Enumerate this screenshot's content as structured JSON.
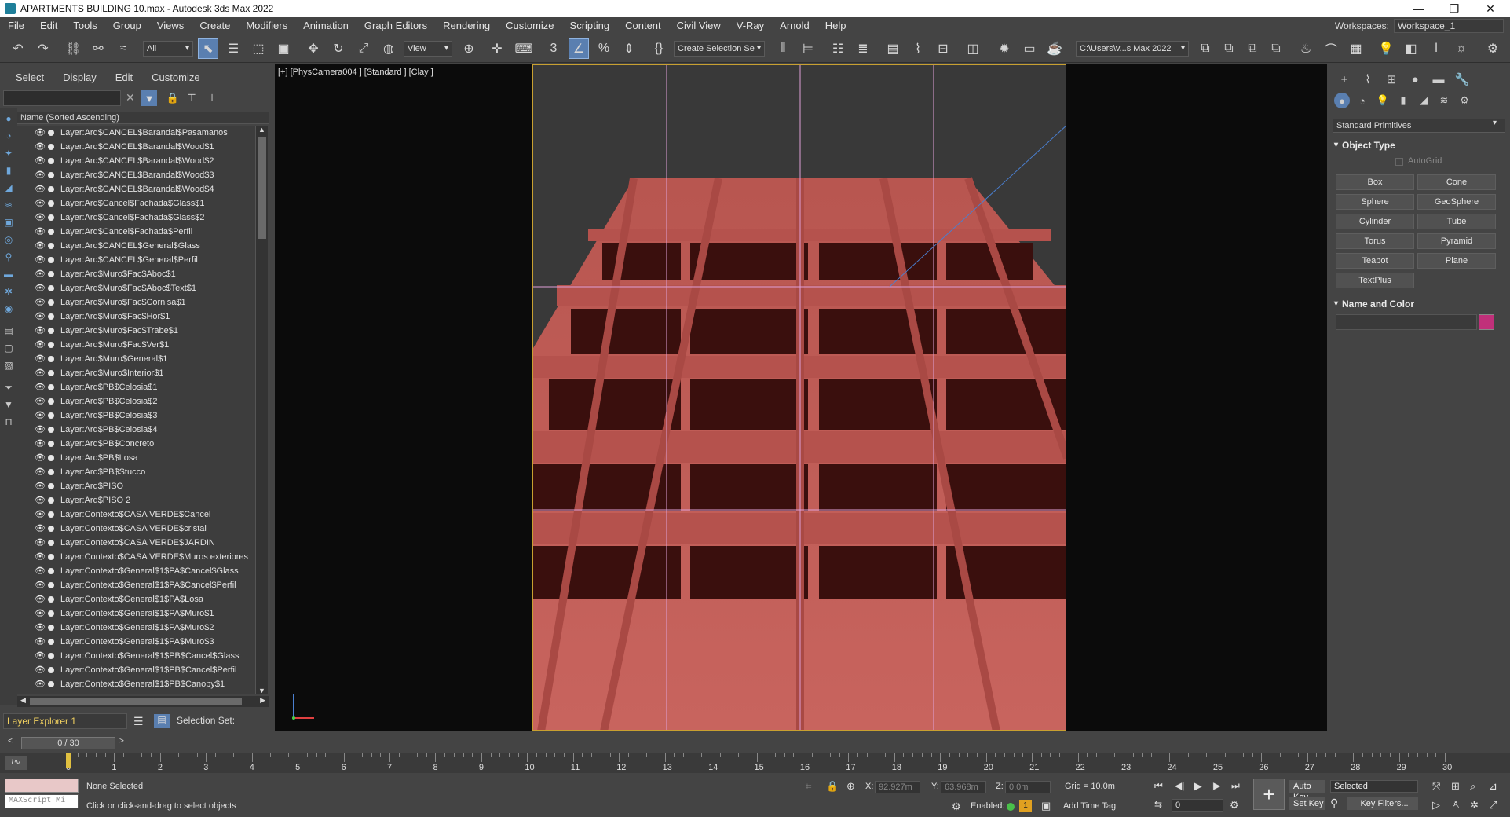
{
  "title": "APARTMENTS BUILDING 10.max - Autodesk 3ds Max 2022",
  "menu": [
    "File",
    "Edit",
    "Tools",
    "Group",
    "Views",
    "Create",
    "Modifiers",
    "Animation",
    "Graph Editors",
    "Rendering",
    "Customize",
    "Scripting",
    "Content",
    "Civil View",
    "V-Ray",
    "Arnold",
    "Help"
  ],
  "workspace": {
    "label": "Workspaces:",
    "value": "Workspace_1"
  },
  "toolbar": {
    "filter": "All",
    "refcoord": "View",
    "selection_set": "Create Selection Se",
    "path": "C:\\Users\\v...s Max 2022"
  },
  "scene_tabs": [
    "Select",
    "Display",
    "Edit",
    "Customize"
  ],
  "layer_header": "Name (Sorted Ascending)",
  "layers": [
    "Layer:Arq$CANCEL$Barandal$Pasamanos",
    "Layer:Arq$CANCEL$Barandal$Wood$1",
    "Layer:Arq$CANCEL$Barandal$Wood$2",
    "Layer:Arq$CANCEL$Barandal$Wood$3",
    "Layer:Arq$CANCEL$Barandal$Wood$4",
    "Layer:Arq$Cancel$Fachada$Glass$1",
    "Layer:Arq$Cancel$Fachada$Glass$2",
    "Layer:Arq$Cancel$Fachada$Perfil",
    "Layer:Arq$CANCEL$General$Glass",
    "Layer:Arq$CANCEL$General$Perfil",
    "Layer:Arq$Muro$Fac$Aboc$1",
    "Layer:Arq$Muro$Fac$Aboc$Text$1",
    "Layer:Arq$Muro$Fac$Cornisa$1",
    "Layer:Arq$Muro$Fac$Hor$1",
    "Layer:Arq$Muro$Fac$Trabe$1",
    "Layer:Arq$Muro$Fac$Ver$1",
    "Layer:Arq$Muro$General$1",
    "Layer:Arq$Muro$Interior$1",
    "Layer:Arq$PB$Celosia$1",
    "Layer:Arq$PB$Celosia$2",
    "Layer:Arq$PB$Celosia$3",
    "Layer:Arq$PB$Celosia$4",
    "Layer:Arq$PB$Concreto",
    "Layer:Arq$PB$Losa",
    "Layer:Arq$PB$Stucco",
    "Layer:Arq$PISO",
    "Layer:Arq$PISO 2",
    "Layer:Contexto$CASA VERDE$Cancel",
    "Layer:Contexto$CASA VERDE$cristal",
    "Layer:Contexto$CASA VERDE$JARDIN",
    "Layer:Contexto$CASA VERDE$Muros exteriores",
    "Layer:Contexto$General$1$PA$Cancel$Glass",
    "Layer:Contexto$General$1$PA$Cancel$Perfil",
    "Layer:Contexto$General$1$PA$Losa",
    "Layer:Contexto$General$1$PA$Muro$1",
    "Layer:Contexto$General$1$PA$Muro$2",
    "Layer:Contexto$General$1$PA$Muro$3",
    "Layer:Contexto$General$1$PB$Cancel$Glass",
    "Layer:Contexto$General$1$PB$Cancel$Perfil",
    "Layer:Contexto$General$1$PB$Canopy$1"
  ],
  "layer_explorer": {
    "name": "Layer Explorer 1",
    "selection_set": "Selection Set:"
  },
  "viewport": {
    "label": "[+] [PhysCamera004 ] [Standard ] [Clay ]",
    "building_color": "#c05a55"
  },
  "command_panel": {
    "category": "Standard Primitives",
    "rollout_object_type": "Object Type",
    "autogrid": "AutoGrid",
    "buttons": [
      "Box",
      "Cone",
      "Sphere",
      "GeoSphere",
      "Cylinder",
      "Tube",
      "Torus",
      "Pyramid",
      "Teapot",
      "Plane",
      "TextPlus"
    ],
    "rollout_name_color": "Name and Color",
    "swatch_color": "#c0307a"
  },
  "time": {
    "slider": "0 / 30",
    "ticks": [
      "0",
      "1",
      "2",
      "3",
      "4",
      "5",
      "6",
      "7",
      "8",
      "9",
      "10",
      "11",
      "12",
      "13",
      "14",
      "15",
      "16",
      "17",
      "18",
      "19",
      "20",
      "21",
      "22",
      "23",
      "24",
      "25",
      "26",
      "27",
      "28",
      "29",
      "30"
    ]
  },
  "status": {
    "maxscript": "MAXScript Mi",
    "selected": "None Selected",
    "prompt": "Click or click-and-drag to select objects",
    "x_label": "X:",
    "x": "92.927m",
    "y_label": "Y:",
    "y": "63.968m",
    "z_label": "Z:",
    "z": "0.0m",
    "grid": "Grid = 10.0m",
    "enabled": "Enabled:",
    "add_time_tag": "Add Time Tag",
    "auto_key": "Auto Key",
    "selected_dd": "Selected",
    "set_key": "Set Key",
    "key_filters": "Key Filters...",
    "frame": "0",
    "enabled_count": "1"
  }
}
